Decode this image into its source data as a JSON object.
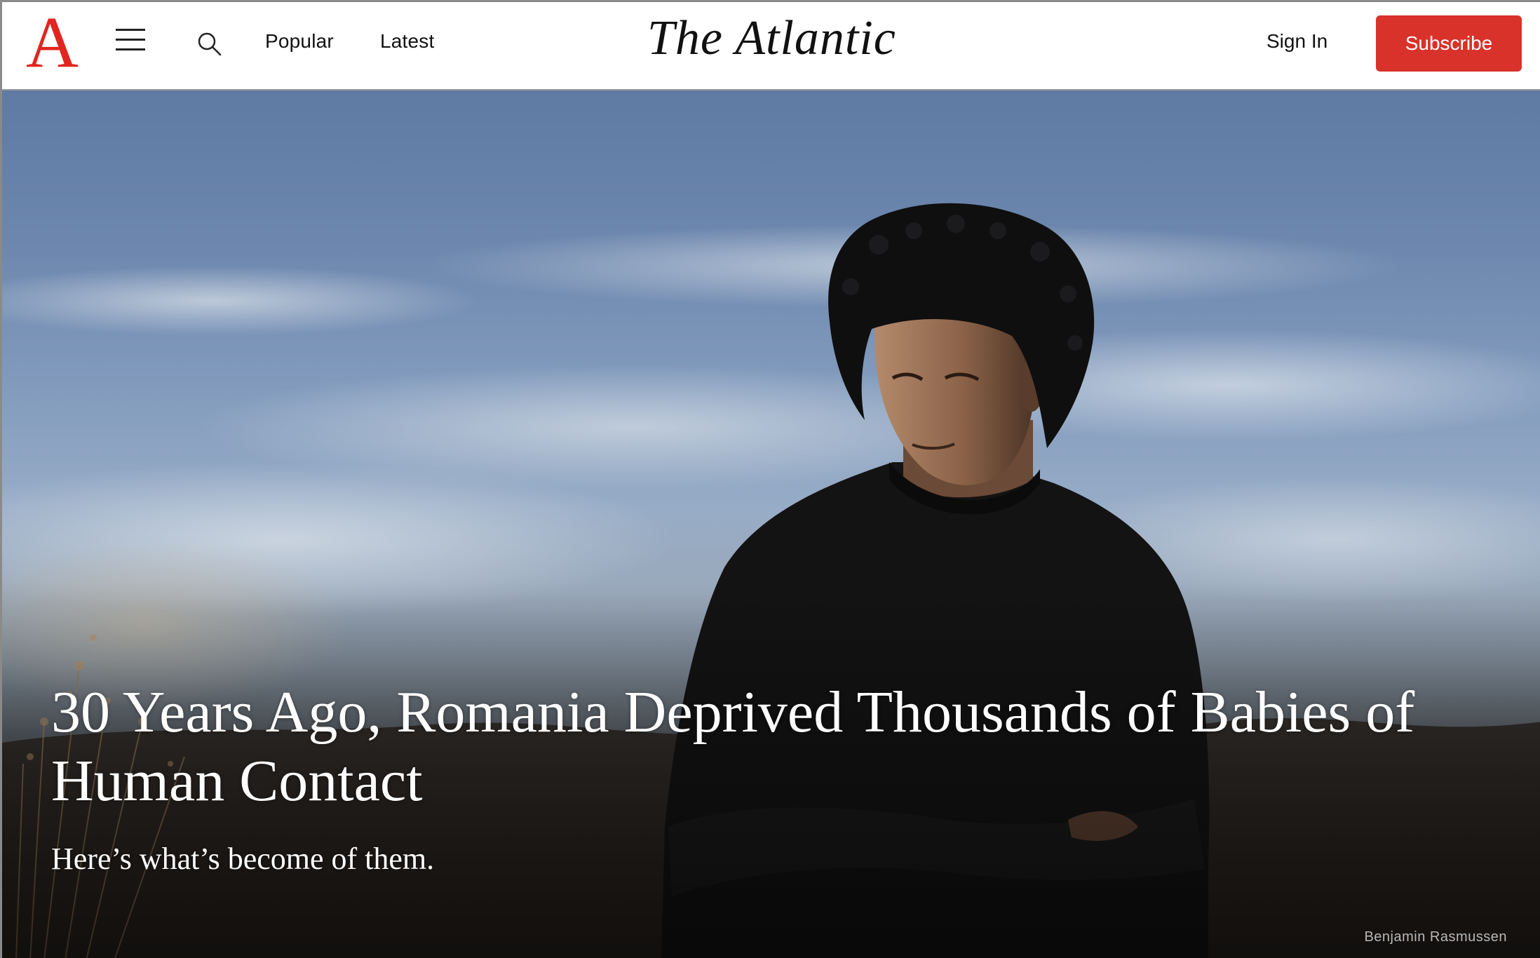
{
  "header": {
    "logo_letter": "A",
    "nav": [
      {
        "label": "Popular"
      },
      {
        "label": "Latest"
      }
    ],
    "masthead": "The Atlantic",
    "sign_in_label": "Sign In",
    "subscribe_label": "Subscribe",
    "icons": [
      "menu-icon",
      "search-icon"
    ]
  },
  "hero": {
    "headline": "30 Years Ago, Romania Deprived Thousands of Babies of Human Contact",
    "dek": "Here’s what’s become of them.",
    "photo_credit": "Benjamin Rasmussen"
  },
  "colors": {
    "brand_red": "#e0261f",
    "subscribe_bg": "#d8322a",
    "text_dark": "#111111",
    "hero_text": "#ffffff"
  }
}
